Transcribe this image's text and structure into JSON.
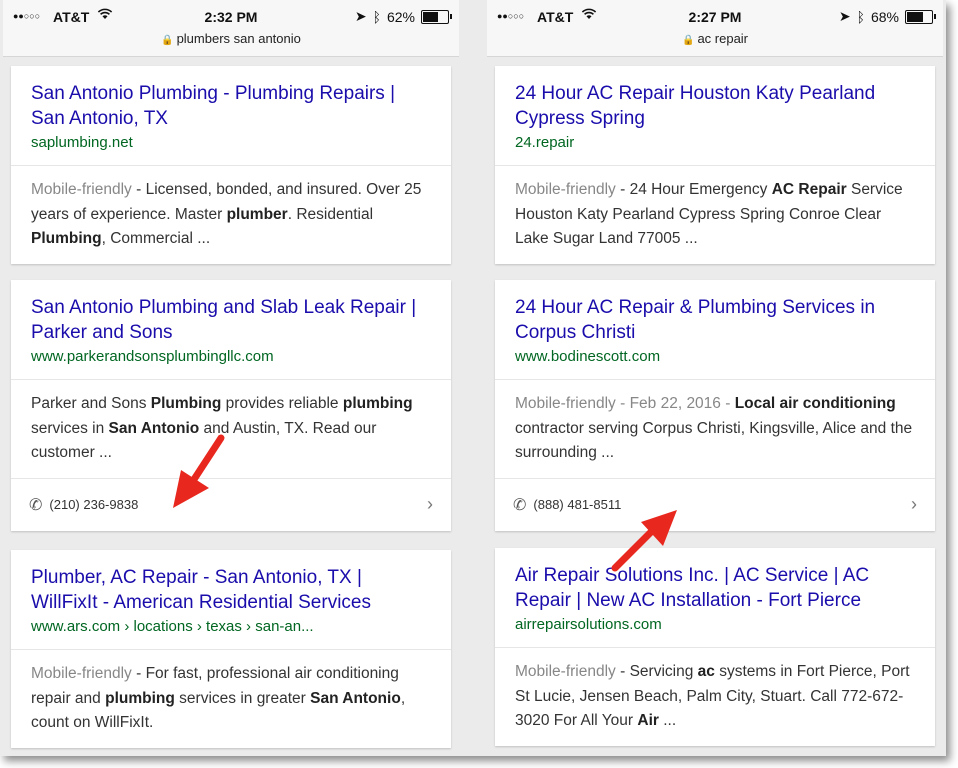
{
  "left": {
    "status": {
      "signal": "●●○○○",
      "carrier": "AT&T",
      "wifi": "wifi-icon",
      "time": "2:32 PM",
      "battery": "62%",
      "battery_level": 0.62
    },
    "url": "plumbers san antonio",
    "results": [
      {
        "title": "San Antonio Plumbing - Plumbing Repairs | San Antonio, TX",
        "url": "saplumbing.net",
        "mobile": "Mobile-friendly",
        "s1": " - Licensed, bonded, and insured. Over 25 years of experience. Master ",
        "b1": "plumber",
        "s2": ". Residential ",
        "b2": "Plumbing",
        "s3": ", Commercial ..."
      },
      {
        "title": "San Antonio Plumbing and Slab Leak Repair | Parker and Sons",
        "url": "www.parkerandsonsplumbingllc.com",
        "s1": "Parker and Sons ",
        "b1": "Plumbing",
        "s2": " provides reliable ",
        "b2": "plumbing",
        "s3": " services in ",
        "b3": "San Antonio",
        "s4": " and Austin, TX. Read our customer ...",
        "phone": "(210) 236-9838"
      },
      {
        "title": "Plumber, AC Repair - San Antonio, TX | WillFixIt - American Residential Services",
        "url": "www.ars.com › locations › texas › san-an...",
        "mobile": "Mobile-friendly",
        "s1": " - For fast, professional air conditioning repair and ",
        "b1": "plumbing",
        "s2": " services in greater ",
        "b2": "San Antonio",
        "s3": ", count on WillFixIt."
      }
    ]
  },
  "right": {
    "status": {
      "signal": "●●○○○",
      "carrier": "AT&T",
      "wifi": "wifi-icon",
      "time": "2:27 PM",
      "battery": "68%",
      "battery_level": 0.68
    },
    "url": "ac repair",
    "results": [
      {
        "title": "24 Hour AC Repair Houston Katy Pearland Cypress Spring",
        "url": "24.repair",
        "mobile": "Mobile-friendly",
        "s1": " - 24 Hour Emergency ",
        "b1": "AC Repair",
        "s2": " Service Houston Katy Pearland Cypress Spring Conroe Clear Lake Sugar Land 77005 ..."
      },
      {
        "title": "24 Hour AC Repair & Plumbing Services in Corpus Christi",
        "url": "www.bodinescott.com",
        "mobile": "Mobile-friendly",
        "date": " - Feb 22, 2016 - ",
        "b1": "Local air conditioning",
        "s2": " contractor serving Corpus Christi, Kingsville, Alice and the surrounding ...",
        "phone": "(888) 481-8511"
      },
      {
        "title": "Air Repair Solutions Inc. | AC Service | AC Repair | New AC Installation - Fort Pierce",
        "url": "airrepairsolutions.com",
        "mobile": "Mobile-friendly",
        "s1": " - Servicing ",
        "b1": "ac",
        "s2": " systems in Fort Pierce, Port St Lucie, Jensen Beach, Palm City, Stuart. Call 772-672-3020 For All Your ",
        "b2": "Air",
        "s3": " ..."
      }
    ]
  },
  "colors": {
    "link": "#1a0dab",
    "url": "#006621",
    "arrow": "#e8281e"
  }
}
